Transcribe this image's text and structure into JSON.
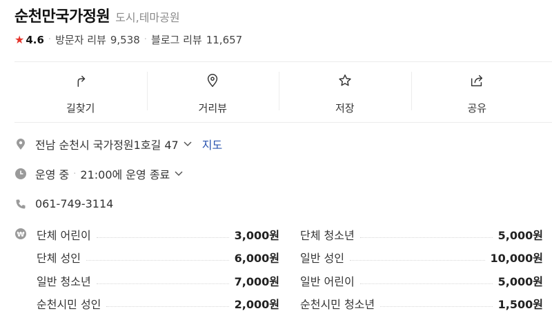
{
  "header": {
    "name": "순천만국가정원",
    "category": "도시,테마공원"
  },
  "rating": {
    "score": "4.6",
    "visitor_label": "방문자 리뷰",
    "visitor_count": "9,538",
    "blog_label": "블로그 리뷰",
    "blog_count": "11,657",
    "star_color": "#e5342b"
  },
  "actions": [
    {
      "label": "길찾기",
      "icon": "directions-icon"
    },
    {
      "label": "거리뷰",
      "icon": "location-pin-icon"
    },
    {
      "label": "저장",
      "icon": "star-outline-icon"
    },
    {
      "label": "공유",
      "icon": "share-icon"
    }
  ],
  "address": {
    "text": "전남 순천시 국가정원1호길 47",
    "map_link": "지도"
  },
  "hours": {
    "status": "운영 중",
    "detail": "21:00에 운영 종료"
  },
  "phone": {
    "number": "061-749-3114"
  },
  "prices": [
    {
      "name": "단체 어린이",
      "price": "3,000원"
    },
    {
      "name": "단체 청소년",
      "price": "5,000원"
    },
    {
      "name": "단체 성인",
      "price": "6,000원"
    },
    {
      "name": "일반 성인",
      "price": "10,000원"
    },
    {
      "name": "일반 청소년",
      "price": "7,000원"
    },
    {
      "name": "일반 어린이",
      "price": "5,000원"
    },
    {
      "name": "순천시민 성인",
      "price": "2,000원"
    },
    {
      "name": "순천시민 청소년",
      "price": "1,500원"
    }
  ],
  "colors": {
    "link": "#2c55b0",
    "icon_gray": "#9a9a9a"
  }
}
